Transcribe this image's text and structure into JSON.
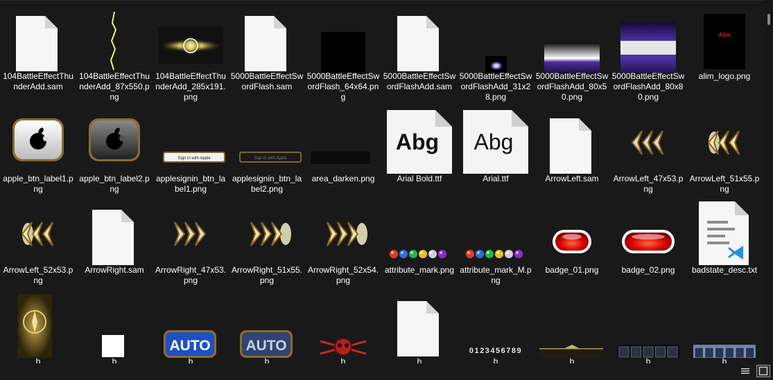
{
  "files": [
    {
      "name": "104BattleEffectThunderAdd.sam",
      "icon": "blank-file-icon"
    },
    {
      "name": "104BattleEffectThunderAdd_87x550.png",
      "icon": "lightning-bolt-thumbnail"
    },
    {
      "name": "104BattleEffectThunderAdd_285x191.png",
      "icon": "glow-orb-thumbnail"
    },
    {
      "name": "5000BattleEffectSwordFlash.sam",
      "icon": "blank-file-icon"
    },
    {
      "name": "5000BattleEffectSwordFlash_64x64.png",
      "icon": "black-square-thumbnail"
    },
    {
      "name": "5000BattleEffectSwordFlashAdd.sam",
      "icon": "blank-file-icon"
    },
    {
      "name": "5000BattleEffectSwordFlashAdd_31x28.png",
      "icon": "purple-spark-thumbnail"
    },
    {
      "name": "5000BattleEffectSwordFlashAdd_80x50.png",
      "icon": "purple-gradient-thumbnail"
    },
    {
      "name": "5000BattleEffectSwordFlashAdd_80x80.png",
      "icon": "purple-band-thumbnail"
    },
    {
      "name": "alim_logo.png",
      "icon": "alim-logo-thumbnail",
      "logo_text": "Alim"
    },
    {
      "name": "apple_btn_label1.png",
      "icon": "apple-button-light-thumbnail"
    },
    {
      "name": "apple_btn_label2.png",
      "icon": "apple-button-dark-thumbnail"
    },
    {
      "name": "applesignin_btn_label1.png",
      "icon": "sign-in-apple-light-thumbnail",
      "thumb_text": "Sign in with Apple"
    },
    {
      "name": "applesignin_btn_label2.png",
      "icon": "sign-in-apple-dark-thumbnail",
      "thumb_text": "Sign in with Apple"
    },
    {
      "name": "area_darken.png",
      "icon": "dark-strip-thumbnail"
    },
    {
      "name": "Arial Bold.ttf",
      "icon": "font-file-bold-icon",
      "thumb_text": "Abg"
    },
    {
      "name": "Arial.ttf",
      "icon": "font-file-icon",
      "thumb_text": "Abg"
    },
    {
      "name": "ArrowLeft.sam",
      "icon": "blank-file-icon"
    },
    {
      "name": "ArrowLeft_47x53.png",
      "icon": "arrow-left-thumbnail"
    },
    {
      "name": "ArrowLeft_51x55.png",
      "icon": "arrow-left-glow-thumbnail"
    },
    {
      "name": "ArrowLeft_52x53.png",
      "icon": "arrow-left-glow-thumbnail"
    },
    {
      "name": "ArrowRight.sam",
      "icon": "blank-file-icon"
    },
    {
      "name": "ArrowRight_47x53.png",
      "icon": "arrow-right-thumbnail"
    },
    {
      "name": "ArrowRight_51x55.png",
      "icon": "arrow-right-glow-thumbnail"
    },
    {
      "name": "ArrowRight_52x54.png",
      "icon": "arrow-right-glow-thumbnail"
    },
    {
      "name": "attribute_mark.png",
      "icon": "attribute-orbs-thumbnail"
    },
    {
      "name": "attribute_mark_M.png",
      "icon": "attribute-orbs-thumbnail"
    },
    {
      "name": "badge_01.png",
      "icon": "red-badge-thumbnail"
    },
    {
      "name": "badge_02.png",
      "icon": "red-badge-wide-thumbnail"
    },
    {
      "name": "badstate_desc.txt",
      "icon": "vscode-text-file-icon"
    },
    {
      "name": "b",
      "icon": "gold-emblem-thumbnail"
    },
    {
      "name": "b",
      "icon": "white-square-thumbnail"
    },
    {
      "name": "b",
      "icon": "auto-button-thumbnail",
      "thumb_text": "AUTO"
    },
    {
      "name": "b",
      "icon": "auto-button-dark-thumbnail",
      "thumb_text": "AUTO"
    },
    {
      "name": "b",
      "icon": "skull-chain-thumbnail"
    },
    {
      "name": "b",
      "icon": "blank-file-icon"
    },
    {
      "name": "b",
      "icon": "digits-thumbnail",
      "thumb_text": "0123456789"
    },
    {
      "name": "b",
      "icon": "dark-bar-thumbnail"
    },
    {
      "name": "b",
      "icon": "slots-bar-thumbnail"
    },
    {
      "name": "b",
      "icon": "blue-frame-thumbnail"
    }
  ],
  "scrollbar": {
    "icon": "vertical-scrollbar"
  },
  "status": {
    "details_view": "details-view-icon",
    "thumbnails_view": "large-icons-view-icon"
  }
}
